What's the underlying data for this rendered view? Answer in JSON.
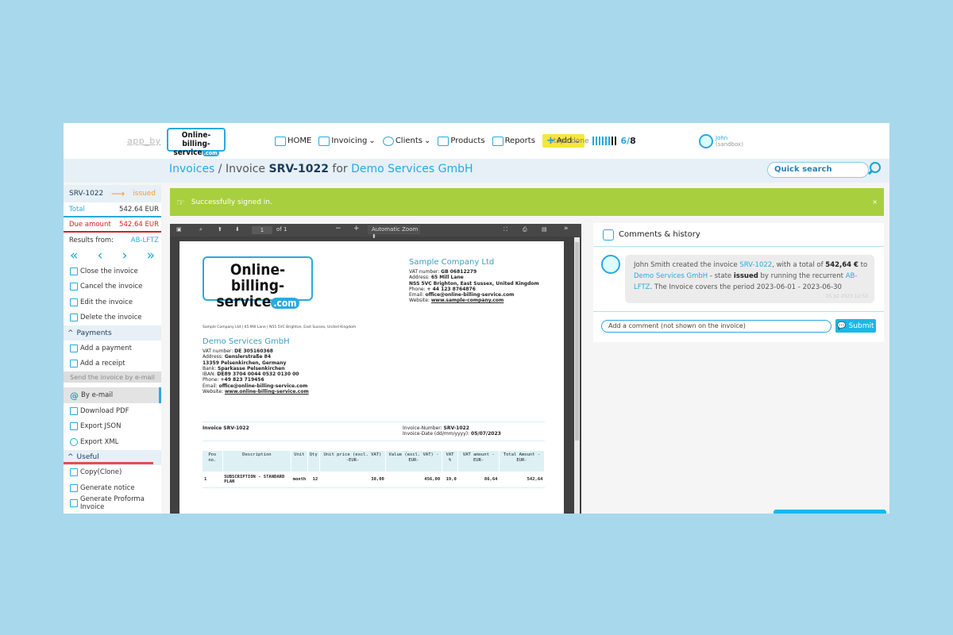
{
  "topbar": {
    "app_by": "app_by",
    "logo_line1": "Online-billing-",
    "logo_line2": "service",
    "logo_dot": ".com",
    "nav": [
      {
        "label": "HOME",
        "icon": "home-icon"
      },
      {
        "label": "Invoicing",
        "icon": "invoice-icon",
        "dropdown": true
      },
      {
        "label": "Clients",
        "icon": "clients-icon",
        "dropdown": true
      },
      {
        "label": "Products",
        "icon": "products-icon"
      },
      {
        "label": "Reports",
        "icon": "reports-icon"
      }
    ],
    "add_label": "Add",
    "steps_label": "steps done",
    "steps_done": 6,
    "steps_total": 8,
    "steps_done_text": "6",
    "steps_total_text": "8",
    "user_name": "John",
    "user_sub": "(sandbox)"
  },
  "breadcrumb": {
    "root": "Invoices",
    "sep": " / Invoice ",
    "invoice": "SRV-1022",
    "for": " for ",
    "client": "Demo Services GmbH"
  },
  "search": {
    "placeholder": "Quick search"
  },
  "sidebar": {
    "invoice_id": "SRV-1022",
    "status": "issued",
    "total_label": "Total",
    "total_value": "542.64 EUR",
    "due_label": "Due amount",
    "due_value": "542.64 EUR",
    "results_label": "Results from:",
    "results_value": "AB-LFTZ",
    "pager": [
      "«",
      "‹",
      "›",
      "»"
    ],
    "actions": [
      {
        "label": "Close the invoice",
        "icon": "close-invoice-icon"
      },
      {
        "label": "Cancel the invoice",
        "icon": "cancel-invoice-icon"
      },
      {
        "label": "Edit the invoice",
        "icon": "edit-invoice-icon"
      },
      {
        "label": "Delete the invoice",
        "icon": "delete-invoice-icon"
      }
    ],
    "payments_title": "Payments",
    "payments": [
      {
        "label": "Add a payment",
        "icon": "payment-icon"
      },
      {
        "label": "Add a receipt",
        "icon": "receipt-icon"
      }
    ],
    "tooltip": "Send the invoice by e-mail",
    "send": [
      {
        "label": "By e-mail",
        "icon": "at-icon"
      },
      {
        "label": "Download PDF",
        "icon": "pdf-icon"
      },
      {
        "label": "Export JSON",
        "icon": "json-icon"
      },
      {
        "label": "Export XML",
        "icon": "xml-icon"
      }
    ],
    "useful_title": "Useful",
    "useful": [
      {
        "label": "Copy(Clone)",
        "icon": "copy-icon"
      },
      {
        "label": "Generate notice",
        "icon": "notice-icon"
      },
      {
        "label": "Generate Proforma Invoice",
        "icon": "proforma-icon"
      }
    ]
  },
  "alert": {
    "message": "Successfully signed in.",
    "close": "×"
  },
  "pdf_viewer": {
    "page": "1",
    "of": "of 1",
    "zoom": "Automatic Zoom",
    "document": {
      "logo_line1": "Online-billing-",
      "logo_line2": "service",
      "logo_dot": ".com",
      "sender": {
        "name": "Sample Company Ltd",
        "vat_label": "VAT number: ",
        "vat": "GB 06812279",
        "address_label": "Address: ",
        "address": "65 Mill Lane",
        "city": "NSS 5VC Brighton, East Sussex, United Kingdom",
        "phone_label": "Phone: ",
        "phone": "+ 44 123 8764876",
        "email_label": "Email: ",
        "email": "office@online-billing-service.com",
        "website_label": "Website: ",
        "website": "www.sample-company.com"
      },
      "from_line": "Sample Company Ltd | 65 Mill Lane | N55 5VC Brighton, East Sussex, United Kingdom",
      "recipient": {
        "name": "Demo Services GmbH",
        "vat_label": "VAT number: ",
        "vat": "DE 305160368",
        "address_label": "Address: ",
        "address": "Genslerstraße 84",
        "city": "13359 Pelsenkirchen, Germany",
        "bank_label": "Bank: ",
        "bank": "Sparkasse Pelsenkirchen",
        "iban_label": "IBAN: ",
        "iban": "DE89 3704 0044 0532 0130 00",
        "phone_label": "Phone: ",
        "phone": "+49 823 719456",
        "email_label": "Email: ",
        "email": "office@online-billing-service.com",
        "website_label": "Website: ",
        "website": "www.online-billing-service.com"
      },
      "invoice_title": "Invoice SRV-1022",
      "number_label": "Invoice-Number: ",
      "number": "SRV-1022",
      "date_label": "Invoice-Date (dd/mm/yyyy): ",
      "date": "05/07/2023",
      "table": {
        "headers": [
          "Pos no.",
          "Description",
          "Unit",
          "Qty",
          "Unit price (excl. VAT) -EUR-",
          "Value (excl. VAT) -EUR-",
          "VAT %",
          "VAT amount -EUR-",
          "Total Amount -EUR-"
        ],
        "rows": [
          [
            "1",
            "SUBSCRIPTION - STANDARD PLAN",
            "month",
            "12",
            "38,00",
            "456,00",
            "19,0",
            "86,64",
            "542,64"
          ]
        ]
      }
    }
  },
  "comments": {
    "title": "Comments & history",
    "entry": {
      "p1": "John Smith created the invoice ",
      "inv": "SRV-1022",
      "p2": ", with a total of ",
      "amount": "542,64 €",
      "p3": " to ",
      "client": "Demo Services GmbH",
      "p4": " - state ",
      "state": "issued",
      "p5": " by running the recurrent ",
      "recurrent": "AB-LFTZ",
      "p6": ". The Invoice covers the period 2023-06-01 - 2023-06-30",
      "timestamp": "05 Jul 2023 12:53"
    },
    "input_placeholder": "Add a comment (not shown on the invoice)",
    "submit": "Submit"
  }
}
